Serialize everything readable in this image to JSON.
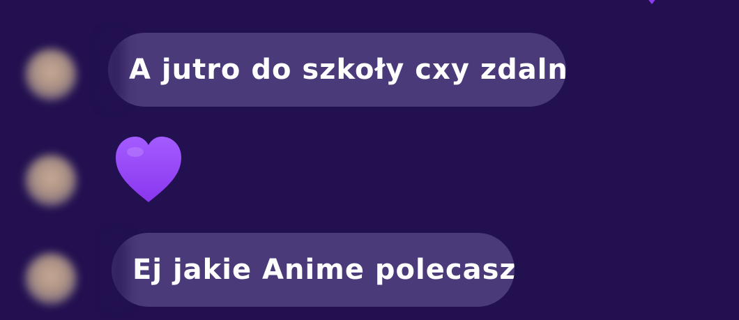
{
  "messages": [
    {
      "type": "text",
      "text": "A jutro do szkoły cxy zdalne"
    },
    {
      "type": "emoji",
      "emoji": "purple-heart"
    },
    {
      "type": "text",
      "text": "Ej jakie Anime polecasz?"
    }
  ],
  "colors": {
    "background": "#221050",
    "bubble": "#4a3a7a",
    "heart": "#9b4cf5",
    "text": "#ffffff"
  }
}
